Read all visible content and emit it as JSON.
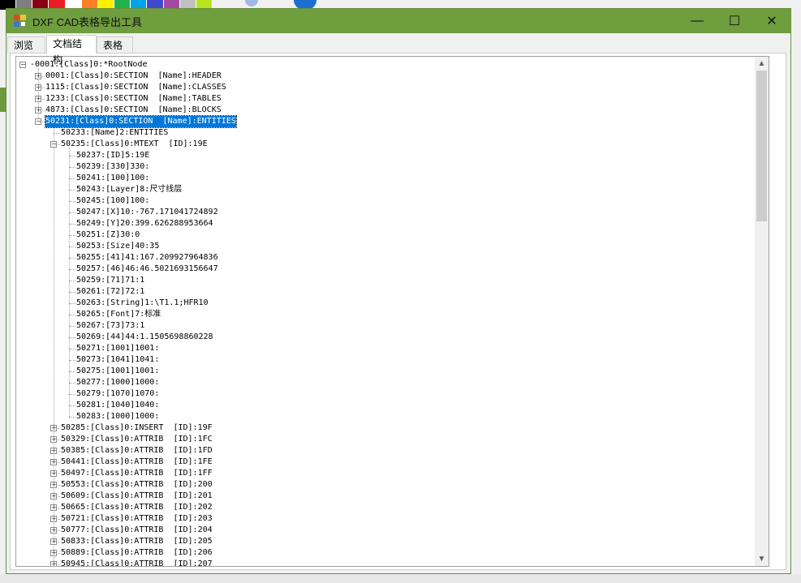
{
  "window": {
    "title": "DXF CAD表格导出工具"
  },
  "controls": {
    "minimize": "—",
    "maximize": "☐",
    "close": "✕"
  },
  "tabs": [
    {
      "label": "浏览"
    },
    {
      "label": "文档结构",
      "active": true
    },
    {
      "label": "表格"
    }
  ],
  "palette_colors": [
    "#000000",
    "#7f7f7f",
    "#880015",
    "#ed1c24",
    "#ffffff",
    "#ff7f27",
    "#fff200",
    "#22b14c",
    "#00a2e8",
    "#3f48cc",
    "#a349a4",
    "#c0c0c0",
    "#b5e61d"
  ],
  "tree": [
    {
      "text": "-0001:[Class]0:*RootNode",
      "level": 0,
      "expander": "minus"
    },
    {
      "text": "0001:[Class]0:SECTION  [Name]:HEADER",
      "level": 1,
      "expander": "plus"
    },
    {
      "text": "1115:[Class]0:SECTION  [Name]:CLASSES",
      "level": 1,
      "expander": "plus"
    },
    {
      "text": "1233:[Class]0:SECTION  [Name]:TABLES",
      "level": 1,
      "expander": "plus"
    },
    {
      "text": "4873:[Class]0:SECTION  [Name]:BLOCKS",
      "level": 1,
      "expander": "plus"
    },
    {
      "text": "50231:[Class]0:SECTION  [Name]:ENTITIES",
      "level": 1,
      "expander": "minus",
      "selected": true
    },
    {
      "text": "50233:[Name]2:ENTITIES",
      "level": 2,
      "expander": "none"
    },
    {
      "text": "50235:[Class]0:MTEXT  [ID]:19E",
      "level": 2,
      "expander": "minus"
    },
    {
      "text": "50237:[ID]5:19E",
      "level": 3,
      "expander": "none"
    },
    {
      "text": "50239:[330]330:",
      "level": 3,
      "expander": "none"
    },
    {
      "text": "50241:[100]100:",
      "level": 3,
      "expander": "none"
    },
    {
      "text": "50243:[Layer]8:尺寸线层",
      "level": 3,
      "expander": "none"
    },
    {
      "text": "50245:[100]100:",
      "level": 3,
      "expander": "none"
    },
    {
      "text": "50247:[X]10:-767.171041724892",
      "level": 3,
      "expander": "none"
    },
    {
      "text": "50249:[Y]20:399.626288953664",
      "level": 3,
      "expander": "none"
    },
    {
      "text": "50251:[Z]30:0",
      "level": 3,
      "expander": "none"
    },
    {
      "text": "50253:[Size]40:35",
      "level": 3,
      "expander": "none"
    },
    {
      "text": "50255:[41]41:167.209927964836",
      "level": 3,
      "expander": "none"
    },
    {
      "text": "50257:[46]46:46.5021693156647",
      "level": 3,
      "expander": "none"
    },
    {
      "text": "50259:[71]71:1",
      "level": 3,
      "expander": "none"
    },
    {
      "text": "50261:[72]72:1",
      "level": 3,
      "expander": "none"
    },
    {
      "text": "50263:[String]1:\\T1.1;HFR10",
      "level": 3,
      "expander": "none"
    },
    {
      "text": "50265:[Font]7:标准",
      "level": 3,
      "expander": "none"
    },
    {
      "text": "50267:[73]73:1",
      "level": 3,
      "expander": "none"
    },
    {
      "text": "50269:[44]44:1.1505698860228",
      "level": 3,
      "expander": "none"
    },
    {
      "text": "50271:[1001]1001:",
      "level": 3,
      "expander": "none"
    },
    {
      "text": "50273:[1041]1041:",
      "level": 3,
      "expander": "none"
    },
    {
      "text": "50275:[1001]1001:",
      "level": 3,
      "expander": "none"
    },
    {
      "text": "50277:[1000]1000:",
      "level": 3,
      "expander": "none"
    },
    {
      "text": "50279:[1070]1070:",
      "level": 3,
      "expander": "none"
    },
    {
      "text": "50281:[1040]1040:",
      "level": 3,
      "expander": "none"
    },
    {
      "text": "50283:[1000]1000:",
      "level": 3,
      "expander": "none"
    },
    {
      "text": "50285:[Class]0:INSERT  [ID]:19F",
      "level": 2,
      "expander": "plus"
    },
    {
      "text": "50329:[Class]0:ATTRIB  [ID]:1FC",
      "level": 2,
      "expander": "plus"
    },
    {
      "text": "50385:[Class]0:ATTRIB  [ID]:1FD",
      "level": 2,
      "expander": "plus"
    },
    {
      "text": "50441:[Class]0:ATTRIB  [ID]:1FE",
      "level": 2,
      "expander": "plus"
    },
    {
      "text": "50497:[Class]0:ATTRIB  [ID]:1FF",
      "level": 2,
      "expander": "plus"
    },
    {
      "text": "50553:[Class]0:ATTRIB  [ID]:200",
      "level": 2,
      "expander": "plus"
    },
    {
      "text": "50609:[Class]0:ATTRIB  [ID]:201",
      "level": 2,
      "expander": "plus"
    },
    {
      "text": "50665:[Class]0:ATTRIB  [ID]:202",
      "level": 2,
      "expander": "plus"
    },
    {
      "text": "50721:[Class]0:ATTRIB  [ID]:203",
      "level": 2,
      "expander": "plus"
    },
    {
      "text": "50777:[Class]0:ATTRIB  [ID]:204",
      "level": 2,
      "expander": "plus"
    },
    {
      "text": "50833:[Class]0:ATTRIB  [ID]:205",
      "level": 2,
      "expander": "plus"
    },
    {
      "text": "50889:[Class]0:ATTRIB  [ID]:206",
      "level": 2,
      "expander": "plus"
    },
    {
      "text": "50945:[Class]0:ATTRIB  [ID]:207",
      "level": 2,
      "expander": "plus"
    }
  ]
}
